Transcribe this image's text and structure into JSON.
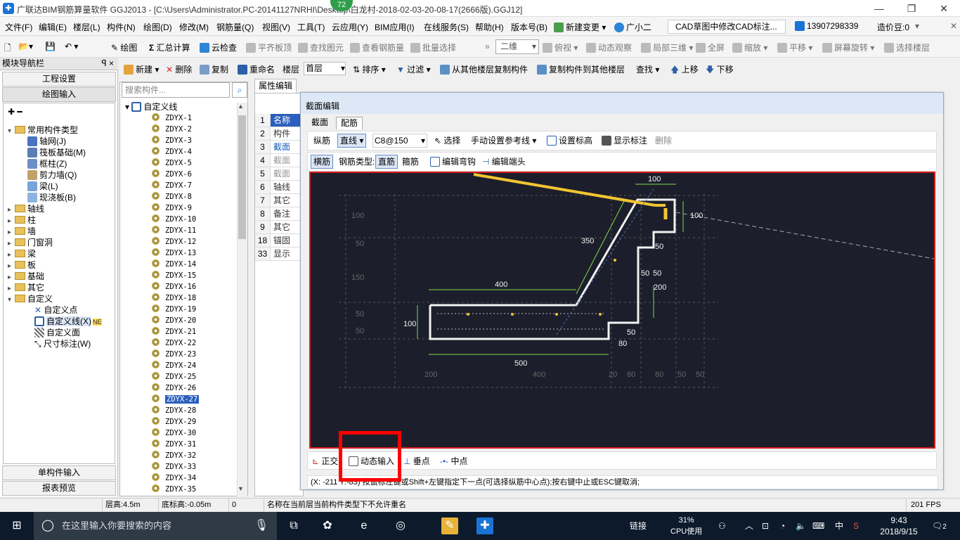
{
  "window": {
    "app_badge": "72",
    "title": "广联达BIM钢筋算量软件 GGJ2013 - [C:\\Users\\Administrator.PC-20141127NRHI\\Desktop\\白龙村-2018-02-03-20-08-17(2666版).GGJ12]",
    "controls": [
      "—",
      "❐",
      "✕"
    ]
  },
  "menubar": {
    "items": [
      "文件(F)",
      "编辑(E)",
      "楼层(L)",
      "构件(N)",
      "绘图(D)",
      "修改(M)",
      "钢筋量(Q)",
      "视图(V)",
      "工具(T)",
      "云应用(Y)",
      "BIM应用(I)",
      "在线服务(S)",
      "帮助(H)",
      "版本号(B)"
    ],
    "change_label": "新建变更",
    "assistant": "广小二",
    "cad_tab": "CAD草图中修改CAD标注...",
    "phone": "13907298339",
    "cost_beans": "造价豆:0"
  },
  "toolbar1": {
    "draw": "绘图",
    "sum": "汇总计算",
    "cloud_check": "云检查",
    "align_slab": "平齐板顶",
    "find_element": "查找图元",
    "view_rebar": "查看钢筋量",
    "batch_select": "批量选择",
    "view_mode": "二维",
    "top_view": "俯视",
    "dynamic_view": "动态观察",
    "local_3d": "局部三维",
    "fullscreen": "全屏",
    "zoom": "缩放",
    "pan": "平移",
    "rotate": "屏幕旋转",
    "select_floor": "选择楼层"
  },
  "nav": {
    "header": "模块导航栏",
    "pin": "ꟼ ×",
    "project_settings": "工程设置",
    "drawing_input": "绘图输入",
    "single_input": "单构件输入",
    "report_preview": "报表预览",
    "tree": {
      "root": "常用构件类型",
      "common": [
        "轴网(J)",
        "筏板基础(M)",
        "框柱(Z)",
        "剪力墙(Q)",
        "梁(L)",
        "现浇板(B)"
      ],
      "folders": [
        "轴线",
        "柱",
        "墙",
        "门窗洞",
        "梁",
        "板",
        "基础",
        "其它"
      ],
      "custom": "自定义",
      "custom_items": [
        "自定义点",
        "自定义线(X)",
        "自定义面",
        "尺寸标注(W)"
      ],
      "new_badge": "NE"
    }
  },
  "list_toolbar": {
    "new": "新建",
    "delete": "删除",
    "copy": "复制",
    "rename": "重命名",
    "floor_label": "楼层",
    "floor_value": "首层",
    "sort": "排序",
    "filter": "过滤",
    "copy_from": "从其他楼层复制构件",
    "copy_to": "复制构件到其他楼层",
    "find": "查找",
    "move_up": "上移",
    "move_down": "下移"
  },
  "list": {
    "search_placeholder": "搜索构件...",
    "root": "自定义线",
    "items": [
      "ZDYX-1",
      "ZDYX-2",
      "ZDYX-3",
      "ZDYX-4",
      "ZDYX-5",
      "ZDYX-6",
      "ZDYX-7",
      "ZDYX-8",
      "ZDYX-9",
      "ZDYX-10",
      "ZDYX-11",
      "ZDYX-12",
      "ZDYX-13",
      "ZDYX-14",
      "ZDYX-15",
      "ZDYX-16",
      "ZDYX-18",
      "ZDYX-19",
      "ZDYX-20",
      "ZDYX-21",
      "ZDYX-22",
      "ZDYX-23",
      "ZDYX-24",
      "ZDYX-25",
      "ZDYX-26",
      "ZDYX-27",
      "ZDYX-28",
      "ZDYX-29",
      "ZDYX-30",
      "ZDYX-31",
      "ZDYX-32",
      "ZDYX-33",
      "ZDYX-34",
      "ZDYX-35"
    ],
    "selected": "ZDYX-27"
  },
  "props": {
    "tab": "属性编辑",
    "rows": [
      {
        "n": "1",
        "t": "名称"
      },
      {
        "n": "2",
        "t": "构件"
      },
      {
        "n": "3",
        "t": "截面"
      },
      {
        "n": "4",
        "t": "截面"
      },
      {
        "n": "5",
        "t": "截面"
      },
      {
        "n": "6",
        "t": "轴线"
      },
      {
        "n": "7",
        "t": "其它"
      },
      {
        "n": "8",
        "t": "备注"
      },
      {
        "n": "9",
        "t": "其它"
      },
      {
        "n": "18",
        "t": "锚固"
      },
      {
        "n": "33",
        "t": "显示"
      }
    ]
  },
  "dialog": {
    "title": "截面编辑",
    "tabs": [
      "截面",
      "配筋"
    ],
    "row1": {
      "longitudinal": "纵筋",
      "line_mode": "直线",
      "spec": "C8@150",
      "select": "选择",
      "ref_line": "手动设置参考线",
      "set_elev": "设置标高",
      "show_dims": "显示标注",
      "delete": "删除"
    },
    "row2": {
      "transverse": "横筋",
      "rebar_type_label": "钢筋类型:",
      "straight": "直筋",
      "stirrup": "箍筋",
      "edit_hook": "编辑弯钩",
      "edit_end": "编辑端头"
    },
    "bottom": {
      "ortho": "正交",
      "dynamic_input": "动态输入",
      "perpendicular": "垂点",
      "midpoint": "中点"
    },
    "status": "(X: -211 Y:-83)  按鼠标左键或Shift+左键指定下一点(可选择纵筋中心点);按右键中止或ESC键取消;"
  },
  "drawing": {
    "dims": [
      "100",
      "100",
      "350",
      "50",
      "50",
      "400",
      "50",
      "200",
      "100",
      "50",
      "80",
      "500"
    ],
    "left_labels": [
      "100",
      "50",
      "150",
      "50",
      "50"
    ],
    "bottom_labels": [
      "200",
      "400",
      "20",
      "80",
      "80",
      "50",
      "50"
    ]
  },
  "statusbar": {
    "floor_height": "层高:4.5m",
    "base_elev": "底标高:-0.05m",
    "zero": "0",
    "message": "名称在当前层当前构件类型下不允许重名",
    "fps": "201 FPS"
  },
  "taskbar": {
    "search_placeholder": "在这里输入你要搜索的内容",
    "link": "链接",
    "cpu_pct": "31%",
    "cpu_label": "CPU使用",
    "ime": "中",
    "time": "9:43",
    "date": "2018/9/15",
    "notif_count": "2"
  }
}
